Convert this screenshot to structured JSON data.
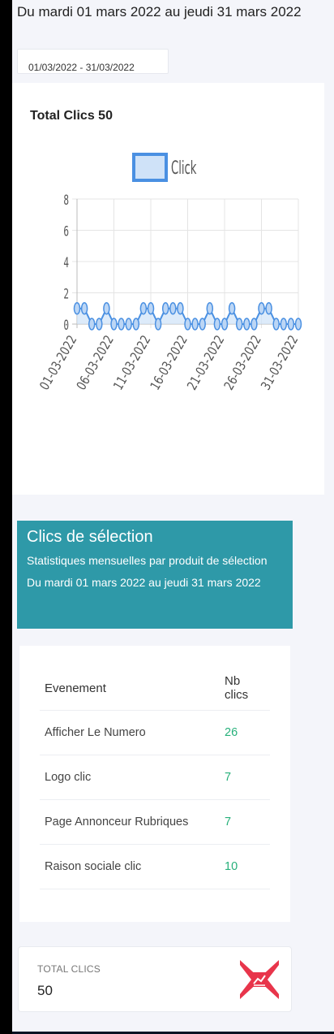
{
  "header": {
    "title": "Du mardi 01 mars 2022 au jeudi 31 mars 2022"
  },
  "date_range": {
    "value": "01/03/2022 - 31/03/2022"
  },
  "chart_card": {
    "title": "Total Clics 50"
  },
  "chart_data": {
    "type": "line",
    "legend": "Click",
    "legend_position": "top",
    "grid": true,
    "series": [
      {
        "name": "Click",
        "color": "#4a90e2",
        "fill": "#cfe2f8",
        "values": [
          1,
          1,
          0,
          0,
          1,
          0,
          0,
          0,
          0,
          1,
          1,
          0,
          1,
          1,
          1,
          0,
          0,
          0,
          1,
          0,
          0,
          1,
          0,
          0,
          0,
          1,
          1,
          0,
          0,
          0,
          0,
          0,
          0,
          0,
          0,
          1
        ]
      }
    ],
    "x": [
      "01-03-2022",
      "02-03-2022",
      "03-03-2022",
      "04-03-2022",
      "05-03-2022",
      "06-03-2022",
      "07-03-2022",
      "08-03-2022",
      "09-03-2022",
      "10-03-2022",
      "11-03-2022",
      "12-03-2022",
      "13-03-2022",
      "14-03-2022",
      "15-03-2022",
      "16-03-2022",
      "17-03-2022",
      "18-03-2022",
      "19-03-2022",
      "20-03-2022",
      "21-03-2022",
      "22-03-2022",
      "23-03-2022",
      "24-03-2022",
      "25-03-2022",
      "26-03-2022",
      "27-03-2022",
      "28-03-2022",
      "29-03-2022",
      "30-03-2022",
      "31-03-2022"
    ],
    "x_ticks": [
      "01-03-2022",
      "06-03-2022",
      "11-03-2022",
      "16-03-2022",
      "21-03-2022",
      "26-03-2022",
      "31-03-2022"
    ],
    "y_ticks": [
      "0",
      "2",
      "4",
      "6",
      "8"
    ],
    "ylim": [
      0,
      8
    ]
  },
  "selection": {
    "title": "Clics de sélection",
    "subtitle": "Statistiques mensuelles par produit de sélection Du mardi 01 mars 2022 au jeudi 31 mars 2022"
  },
  "table": {
    "headers": [
      "Evenement",
      "Nb clics"
    ],
    "rows": [
      {
        "event": "Afficher Le Numero",
        "clicks": "26"
      },
      {
        "event": "Logo clic",
        "clicks": "7"
      },
      {
        "event": "Page Annonceur Rubriques",
        "clicks": "7"
      },
      {
        "event": "Raison sociale clic",
        "clicks": "10"
      }
    ]
  },
  "total": {
    "label": "TOTAL CLICS",
    "value": "50",
    "icon": "chart-trend-icon",
    "icon_color": "#e8354b"
  }
}
